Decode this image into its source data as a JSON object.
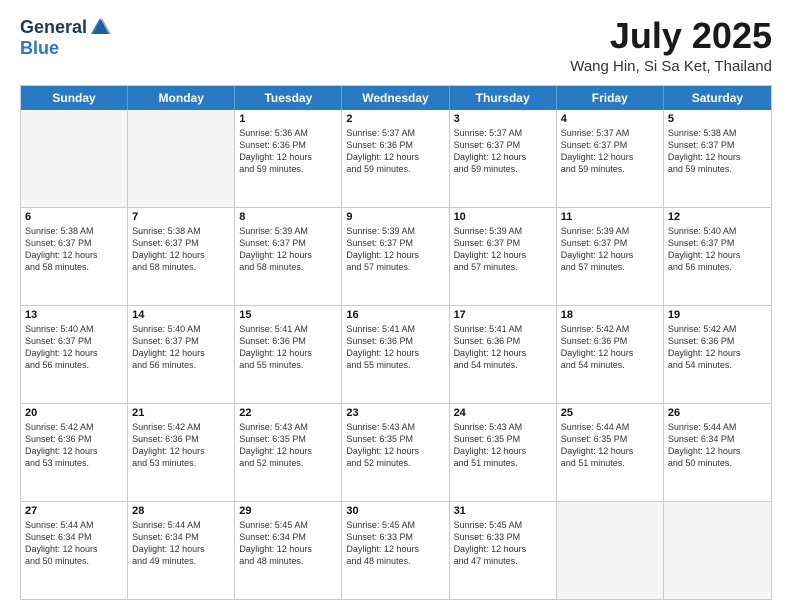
{
  "logo": {
    "general": "General",
    "blue": "Blue"
  },
  "title": {
    "month": "July 2025",
    "location": "Wang Hin, Si Sa Ket, Thailand"
  },
  "calendar": {
    "headers": [
      "Sunday",
      "Monday",
      "Tuesday",
      "Wednesday",
      "Thursday",
      "Friday",
      "Saturday"
    ],
    "rows": [
      [
        {
          "day": "",
          "empty": true
        },
        {
          "day": "",
          "empty": true
        },
        {
          "day": "1",
          "lines": [
            "Sunrise: 5:36 AM",
            "Sunset: 6:36 PM",
            "Daylight: 12 hours",
            "and 59 minutes."
          ]
        },
        {
          "day": "2",
          "lines": [
            "Sunrise: 5:37 AM",
            "Sunset: 6:36 PM",
            "Daylight: 12 hours",
            "and 59 minutes."
          ]
        },
        {
          "day": "3",
          "lines": [
            "Sunrise: 5:37 AM",
            "Sunset: 6:37 PM",
            "Daylight: 12 hours",
            "and 59 minutes."
          ]
        },
        {
          "day": "4",
          "lines": [
            "Sunrise: 5:37 AM",
            "Sunset: 6:37 PM",
            "Daylight: 12 hours",
            "and 59 minutes."
          ]
        },
        {
          "day": "5",
          "lines": [
            "Sunrise: 5:38 AM",
            "Sunset: 6:37 PM",
            "Daylight: 12 hours",
            "and 59 minutes."
          ]
        }
      ],
      [
        {
          "day": "6",
          "lines": [
            "Sunrise: 5:38 AM",
            "Sunset: 6:37 PM",
            "Daylight: 12 hours",
            "and 58 minutes."
          ]
        },
        {
          "day": "7",
          "lines": [
            "Sunrise: 5:38 AM",
            "Sunset: 6:37 PM",
            "Daylight: 12 hours",
            "and 58 minutes."
          ]
        },
        {
          "day": "8",
          "lines": [
            "Sunrise: 5:39 AM",
            "Sunset: 6:37 PM",
            "Daylight: 12 hours",
            "and 58 minutes."
          ]
        },
        {
          "day": "9",
          "lines": [
            "Sunrise: 5:39 AM",
            "Sunset: 6:37 PM",
            "Daylight: 12 hours",
            "and 57 minutes."
          ]
        },
        {
          "day": "10",
          "lines": [
            "Sunrise: 5:39 AM",
            "Sunset: 6:37 PM",
            "Daylight: 12 hours",
            "and 57 minutes."
          ]
        },
        {
          "day": "11",
          "lines": [
            "Sunrise: 5:39 AM",
            "Sunset: 6:37 PM",
            "Daylight: 12 hours",
            "and 57 minutes."
          ]
        },
        {
          "day": "12",
          "lines": [
            "Sunrise: 5:40 AM",
            "Sunset: 6:37 PM",
            "Daylight: 12 hours",
            "and 56 minutes."
          ]
        }
      ],
      [
        {
          "day": "13",
          "lines": [
            "Sunrise: 5:40 AM",
            "Sunset: 6:37 PM",
            "Daylight: 12 hours",
            "and 56 minutes."
          ]
        },
        {
          "day": "14",
          "lines": [
            "Sunrise: 5:40 AM",
            "Sunset: 6:37 PM",
            "Daylight: 12 hours",
            "and 56 minutes."
          ]
        },
        {
          "day": "15",
          "lines": [
            "Sunrise: 5:41 AM",
            "Sunset: 6:36 PM",
            "Daylight: 12 hours",
            "and 55 minutes."
          ]
        },
        {
          "day": "16",
          "lines": [
            "Sunrise: 5:41 AM",
            "Sunset: 6:36 PM",
            "Daylight: 12 hours",
            "and 55 minutes."
          ]
        },
        {
          "day": "17",
          "lines": [
            "Sunrise: 5:41 AM",
            "Sunset: 6:36 PM",
            "Daylight: 12 hours",
            "and 54 minutes."
          ]
        },
        {
          "day": "18",
          "lines": [
            "Sunrise: 5:42 AM",
            "Sunset: 6:36 PM",
            "Daylight: 12 hours",
            "and 54 minutes."
          ]
        },
        {
          "day": "19",
          "lines": [
            "Sunrise: 5:42 AM",
            "Sunset: 6:36 PM",
            "Daylight: 12 hours",
            "and 54 minutes."
          ]
        }
      ],
      [
        {
          "day": "20",
          "lines": [
            "Sunrise: 5:42 AM",
            "Sunset: 6:36 PM",
            "Daylight: 12 hours",
            "and 53 minutes."
          ]
        },
        {
          "day": "21",
          "lines": [
            "Sunrise: 5:42 AM",
            "Sunset: 6:36 PM",
            "Daylight: 12 hours",
            "and 53 minutes."
          ]
        },
        {
          "day": "22",
          "lines": [
            "Sunrise: 5:43 AM",
            "Sunset: 6:35 PM",
            "Daylight: 12 hours",
            "and 52 minutes."
          ]
        },
        {
          "day": "23",
          "lines": [
            "Sunrise: 5:43 AM",
            "Sunset: 6:35 PM",
            "Daylight: 12 hours",
            "and 52 minutes."
          ]
        },
        {
          "day": "24",
          "lines": [
            "Sunrise: 5:43 AM",
            "Sunset: 6:35 PM",
            "Daylight: 12 hours",
            "and 51 minutes."
          ]
        },
        {
          "day": "25",
          "lines": [
            "Sunrise: 5:44 AM",
            "Sunset: 6:35 PM",
            "Daylight: 12 hours",
            "and 51 minutes."
          ]
        },
        {
          "day": "26",
          "lines": [
            "Sunrise: 5:44 AM",
            "Sunset: 6:34 PM",
            "Daylight: 12 hours",
            "and 50 minutes."
          ]
        }
      ],
      [
        {
          "day": "27",
          "lines": [
            "Sunrise: 5:44 AM",
            "Sunset: 6:34 PM",
            "Daylight: 12 hours",
            "and 50 minutes."
          ]
        },
        {
          "day": "28",
          "lines": [
            "Sunrise: 5:44 AM",
            "Sunset: 6:34 PM",
            "Daylight: 12 hours",
            "and 49 minutes."
          ]
        },
        {
          "day": "29",
          "lines": [
            "Sunrise: 5:45 AM",
            "Sunset: 6:34 PM",
            "Daylight: 12 hours",
            "and 48 minutes."
          ]
        },
        {
          "day": "30",
          "lines": [
            "Sunrise: 5:45 AM",
            "Sunset: 6:33 PM",
            "Daylight: 12 hours",
            "and 48 minutes."
          ]
        },
        {
          "day": "31",
          "lines": [
            "Sunrise: 5:45 AM",
            "Sunset: 6:33 PM",
            "Daylight: 12 hours",
            "and 47 minutes."
          ]
        },
        {
          "day": "",
          "empty": true
        },
        {
          "day": "",
          "empty": true
        }
      ]
    ]
  }
}
